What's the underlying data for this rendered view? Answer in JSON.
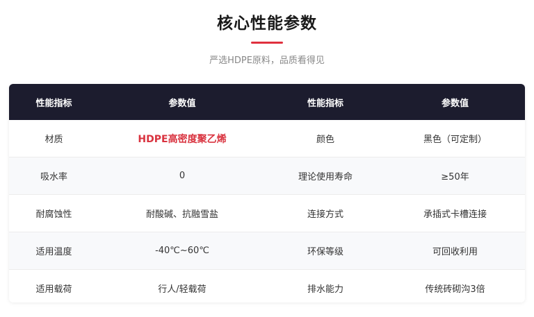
{
  "section": {
    "title": "核心性能参数",
    "subtitle": "严选HDPE原料，品质看得见",
    "accent_color": "#e0303e"
  },
  "table": {
    "headers": [
      "性能指标",
      "参数值",
      "性能指标",
      "参数值"
    ],
    "rows": [
      [
        "材质",
        "HDPE高密度聚乙烯",
        "颜色",
        "黑色（可定制）"
      ],
      [
        "吸水率",
        "0",
        "理论使用寿命",
        "≥50年"
      ],
      [
        "耐腐蚀性",
        "耐酸碱、抗融雪盐",
        "连接方式",
        "承插式卡槽连接"
      ],
      [
        "适用温度",
        "-40℃~60℃",
        "环保等级",
        "可回收利用"
      ],
      [
        "适用载荷",
        "行人/轻载荷",
        "排水能力",
        "传统砖砌沟3倍"
      ]
    ],
    "header_bg": "#1c1c2e",
    "highlight_color": "#d9333f"
  }
}
